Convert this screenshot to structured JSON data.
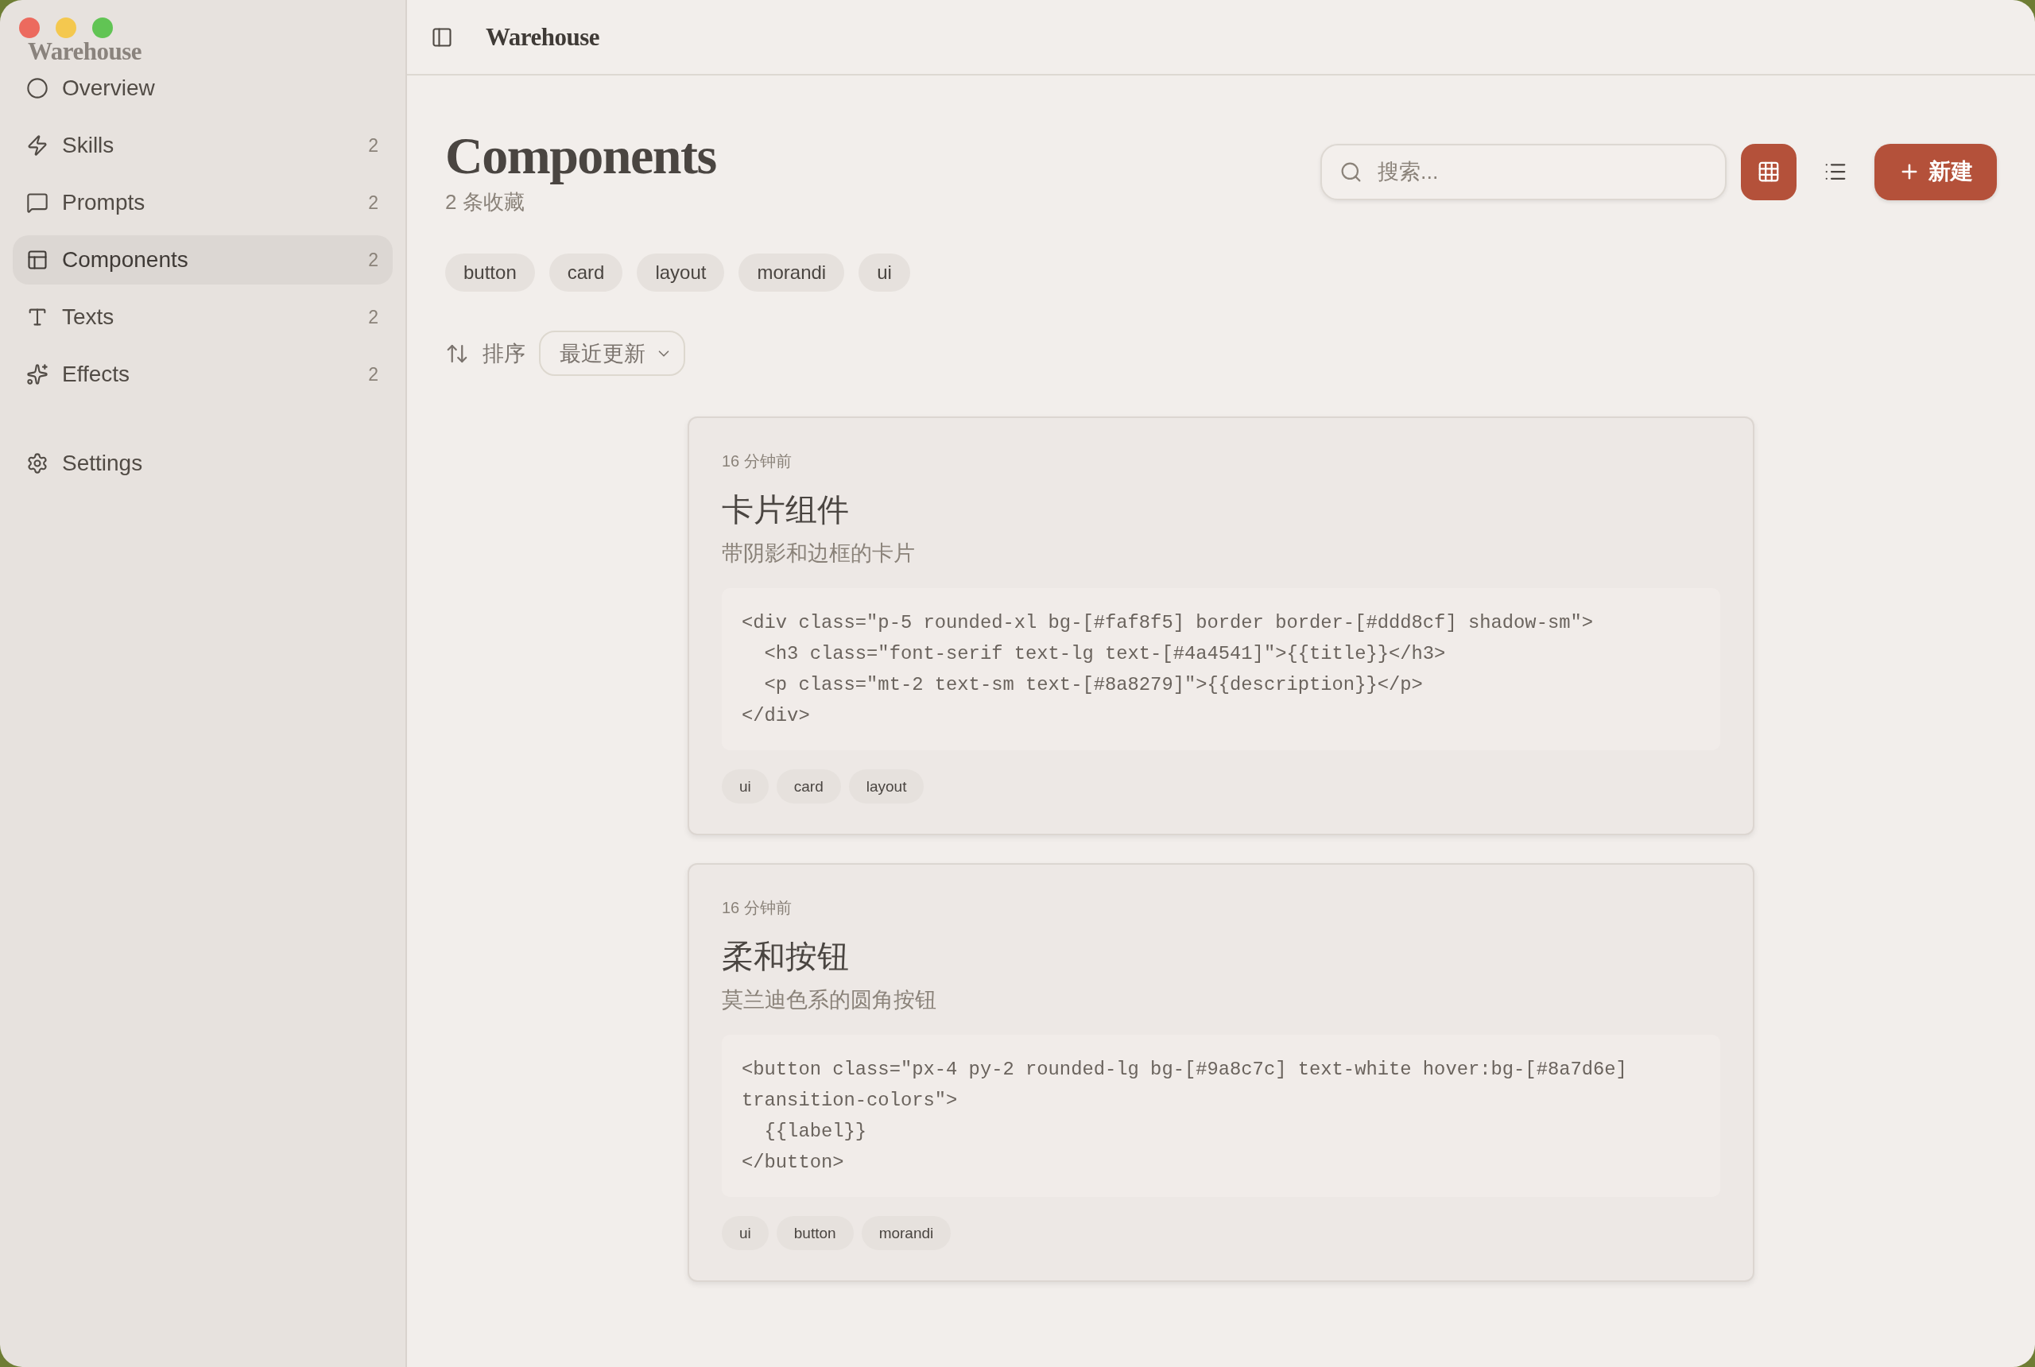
{
  "sidebar": {
    "brand": "Warehouse",
    "items": [
      {
        "label": "Overview",
        "selected": false
      },
      {
        "label": "Skills",
        "count": "2",
        "selected": false
      },
      {
        "label": "Prompts",
        "count": "2",
        "selected": false
      },
      {
        "label": "Components",
        "count": "2",
        "selected": true
      },
      {
        "label": "Texts",
        "count": "2",
        "selected": false
      },
      {
        "label": "Effects",
        "count": "2",
        "selected": false
      }
    ],
    "settings": {
      "label": "Settings",
      "selected": false
    }
  },
  "header": {
    "title": "Warehouse"
  },
  "page": {
    "title": "Components",
    "subtitle": "2 条收藏"
  },
  "search": {
    "placeholder": "搜索..."
  },
  "view_toggle": [
    {
      "kind": "grid",
      "selected": true
    },
    {
      "kind": "list",
      "selected": false
    }
  ],
  "new_button": {
    "label": "新建"
  },
  "tag_filters": [
    {
      "label": "button",
      "selected": false
    },
    {
      "label": "card",
      "selected": false
    },
    {
      "label": "layout",
      "selected": false
    },
    {
      "label": "morandi",
      "selected": false
    },
    {
      "label": "ui",
      "selected": false
    }
  ],
  "sort": {
    "label": "排序",
    "value": "最近更新"
  },
  "cards": [
    {
      "time": "16 分钟前",
      "title": "卡片组件",
      "description": "带阴影和边框的卡片",
      "code": "<div class=\"p-5 rounded-xl bg-[#faf8f5] border border-[#ddd8cf] shadow-sm\">\n  <h3 class=\"font-serif text-lg text-[#4a4541]\">{{title}}</h3>\n  <p class=\"mt-2 text-sm text-[#8a8279]\">{{description}}</p>\n</div>",
      "tags": [
        "ui",
        "card",
        "layout"
      ]
    },
    {
      "time": "16 分钟前",
      "title": "柔和按钮",
      "description": "莫兰迪色系的圆角按钮",
      "code": "<button class=\"px-4 py-2 rounded-lg bg-[#9a8c7c] text-white hover:bg-[#8a7d6e] transition-colors\">\n  {{label}}\n</button>",
      "tags": [
        "ui",
        "button",
        "morandi"
      ]
    }
  ]
}
